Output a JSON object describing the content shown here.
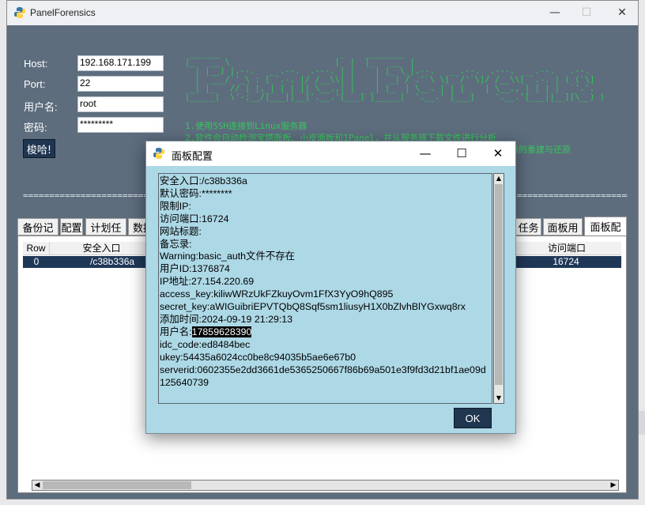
{
  "main_window": {
    "title": "PanelForensics",
    "controls": {
      "minimize": "—",
      "maximize": "☐",
      "close": "✕"
    }
  },
  "form": {
    "host_label": "Host:",
    "host_value": "192.168.171.199",
    "port_label": "Port:",
    "port_value": "22",
    "user_label": "用户名:",
    "user_value": "root",
    "password_label": "密码:",
    "password_value": "*********",
    "go_button": "梭哈!"
  },
  "banner": {
    "ascii": " ______                        _    ________\n|_   __ \\                     [  |  |_   __  |\n  | |__) |,--.   _ .--.  .---. | |    | |_ \\_|.--.   _ .--.  .---.  _ .--.   .--.\n  |  ___/`'_\\ : [ `.-. |/ /__\\\\| |    |  _| / .'`\\ \\[ `/'`\\]/ /__\\\\[ `.-. | ( (`\\]\n _| |_   // | |, | | | || \\__.,| |   _| |_  | \\__. | | |    | \\__., | | | |  `'.'.\n|_____|  \\'-;__/[___||__]'.__.'[___] |_____|  '.__.' [___]    '.__.'[___||__][\\__) )",
    "lines": [
      "1.使用SSH连接到Linux服务器",
      "2.软件会自动检测宝塔面板、小皮面板和1Panel，并从服务器下载文件进行分析",
      "码的重建与还原"
    ]
  },
  "separator": "==========================================================================================================================================",
  "tabs": {
    "left": [
      "备份记",
      "配置",
      "计划任",
      "数据"
    ],
    "right": [
      "任务",
      "面板用",
      "面板配"
    ],
    "active": "面板配"
  },
  "table": {
    "columns": [
      "Row",
      "安全入口",
      "访问端口"
    ],
    "rows": [
      {
        "row": "0",
        "entry": "/c38b336a",
        "port": "16724"
      }
    ]
  },
  "dialog": {
    "title": "面板配置",
    "controls": {
      "minimize": "—",
      "maximize": "☐",
      "close": "✕"
    },
    "lines": [
      {
        "label": "安全入口:",
        "value": "/c38b336a"
      },
      {
        "label": "默认密码:",
        "value": "********"
      },
      {
        "label": "限制IP:",
        "value": ""
      },
      {
        "label": "访问端口:",
        "value": "16724"
      },
      {
        "label": "网站标题:",
        "value": ""
      },
      {
        "label": "备忘录:",
        "value": ""
      },
      {
        "label": "Warning:",
        "value": "basic_auth文件不存在"
      },
      {
        "label": "用户ID:",
        "value": "1376874"
      },
      {
        "label": "IP地址:",
        "value": "27.154.220.69"
      },
      {
        "label": "access_key:",
        "value": "kiliwWRzUkFZkuyOvm1FfX3YyO9hQ895"
      },
      {
        "label": "secret_key:",
        "value": "aWIGuibriEPVTQbQ8Sqf5sm1liusyH1X0bZlvhBlYGxwq8rx"
      },
      {
        "label": "添加时间:",
        "value": "2024-09-19 21:29:13"
      },
      {
        "label": "用户名:",
        "value": "17859628390"
      },
      {
        "label": "idc_code:",
        "value": "ed8484bec"
      },
      {
        "label": "ukey:",
        "value": "54435a6024cc0be8c94035b5ae6e67b0"
      },
      {
        "label": "serverid:",
        "value": "0602355e2dd3661de5365250667f86b69a501e3f9fd3d21bf1ae09d"
      },
      {
        "label": "",
        "value": "125640739"
      }
    ],
    "ok_button": "OK"
  },
  "colors": {
    "window_bg": "#5d6d7e",
    "button_bg": "#203650",
    "banner_green": "#35c85a",
    "dialog_bg": "#add8e6",
    "row_selected": "#1f3858"
  }
}
